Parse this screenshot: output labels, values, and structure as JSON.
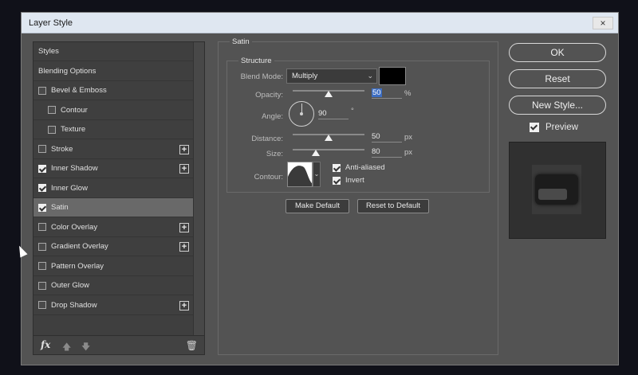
{
  "window": {
    "title": "Layer Style",
    "close_icon": "×"
  },
  "styles_list": [
    {
      "label": "Styles",
      "checkbox": false,
      "checked": false,
      "indent": 0,
      "plus": false,
      "selected": false
    },
    {
      "label": "Blending Options",
      "checkbox": false,
      "checked": false,
      "indent": 0,
      "plus": false,
      "selected": false
    },
    {
      "label": "Bevel & Emboss",
      "checkbox": true,
      "checked": false,
      "indent": 0,
      "plus": false,
      "selected": false
    },
    {
      "label": "Contour",
      "checkbox": true,
      "checked": false,
      "indent": 1,
      "plus": false,
      "selected": false
    },
    {
      "label": "Texture",
      "checkbox": true,
      "checked": false,
      "indent": 1,
      "plus": false,
      "selected": false
    },
    {
      "label": "Stroke",
      "checkbox": true,
      "checked": false,
      "indent": 0,
      "plus": true,
      "selected": false
    },
    {
      "label": "Inner Shadow",
      "checkbox": true,
      "checked": true,
      "indent": 0,
      "plus": true,
      "selected": false
    },
    {
      "label": "Inner Glow",
      "checkbox": true,
      "checked": true,
      "indent": 0,
      "plus": false,
      "selected": false
    },
    {
      "label": "Satin",
      "checkbox": true,
      "checked": true,
      "indent": 0,
      "plus": false,
      "selected": true
    },
    {
      "label": "Color Overlay",
      "checkbox": true,
      "checked": false,
      "indent": 0,
      "plus": true,
      "selected": false
    },
    {
      "label": "Gradient Overlay",
      "checkbox": true,
      "checked": false,
      "indent": 0,
      "plus": true,
      "selected": false
    },
    {
      "label": "Pattern Overlay",
      "checkbox": true,
      "checked": false,
      "indent": 0,
      "plus": false,
      "selected": false
    },
    {
      "label": "Outer Glow",
      "checkbox": true,
      "checked": false,
      "indent": 0,
      "plus": false,
      "selected": false
    },
    {
      "label": "Drop Shadow",
      "checkbox": true,
      "checked": false,
      "indent": 0,
      "plus": true,
      "selected": false
    }
  ],
  "footer": {
    "fx_label": "fx",
    "up_icon": "🡅",
    "down_icon": "🡇",
    "trash_icon": "🗑"
  },
  "satin": {
    "group_label": "Satin",
    "structure_label": "Structure",
    "blend_mode": {
      "label": "Blend Mode:",
      "value": "Multiply",
      "color": "#000000"
    },
    "opacity": {
      "label": "Opacity:",
      "value": "50",
      "unit": "%",
      "percent": 50
    },
    "angle": {
      "label": "Angle:",
      "value": "90",
      "unit": "°"
    },
    "distance": {
      "label": "Distance:",
      "value": "50",
      "unit": "px",
      "percent": 50
    },
    "size": {
      "label": "Size:",
      "value": "80",
      "unit": "px",
      "percent": 32
    },
    "contour": {
      "label": "Contour:",
      "anti_aliased": "Anti-aliased",
      "invert": "Invert"
    },
    "make_default": "Make Default",
    "reset_default": "Reset to Default"
  },
  "actions": {
    "ok": "OK",
    "reset": "Reset",
    "new_style": "New Style...",
    "preview": "Preview"
  }
}
